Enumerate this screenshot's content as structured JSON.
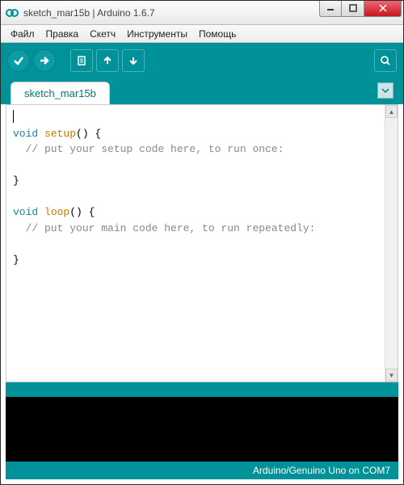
{
  "window": {
    "title": "sketch_mar15b | Arduino 1.6.7"
  },
  "menu": {
    "file": "Файл",
    "edit": "Правка",
    "sketch": "Скетч",
    "tools": "Инструменты",
    "help": "Помощь"
  },
  "tabs": {
    "active": "sketch_mar15b"
  },
  "code": {
    "l1_kw": "void",
    "l1_fn": " setup",
    "l1_rest": "() {",
    "l2": "  // put your setup code here, to run once:",
    "l3": "",
    "l4": "}",
    "l5": "",
    "l6_kw": "void",
    "l6_fn": " loop",
    "l6_rest": "() {",
    "l7": "  // put your main code here, to run repeatedly:",
    "l8": "",
    "l9": "}"
  },
  "footer": {
    "board": "Arduino/Genuino Uno on COM7"
  }
}
